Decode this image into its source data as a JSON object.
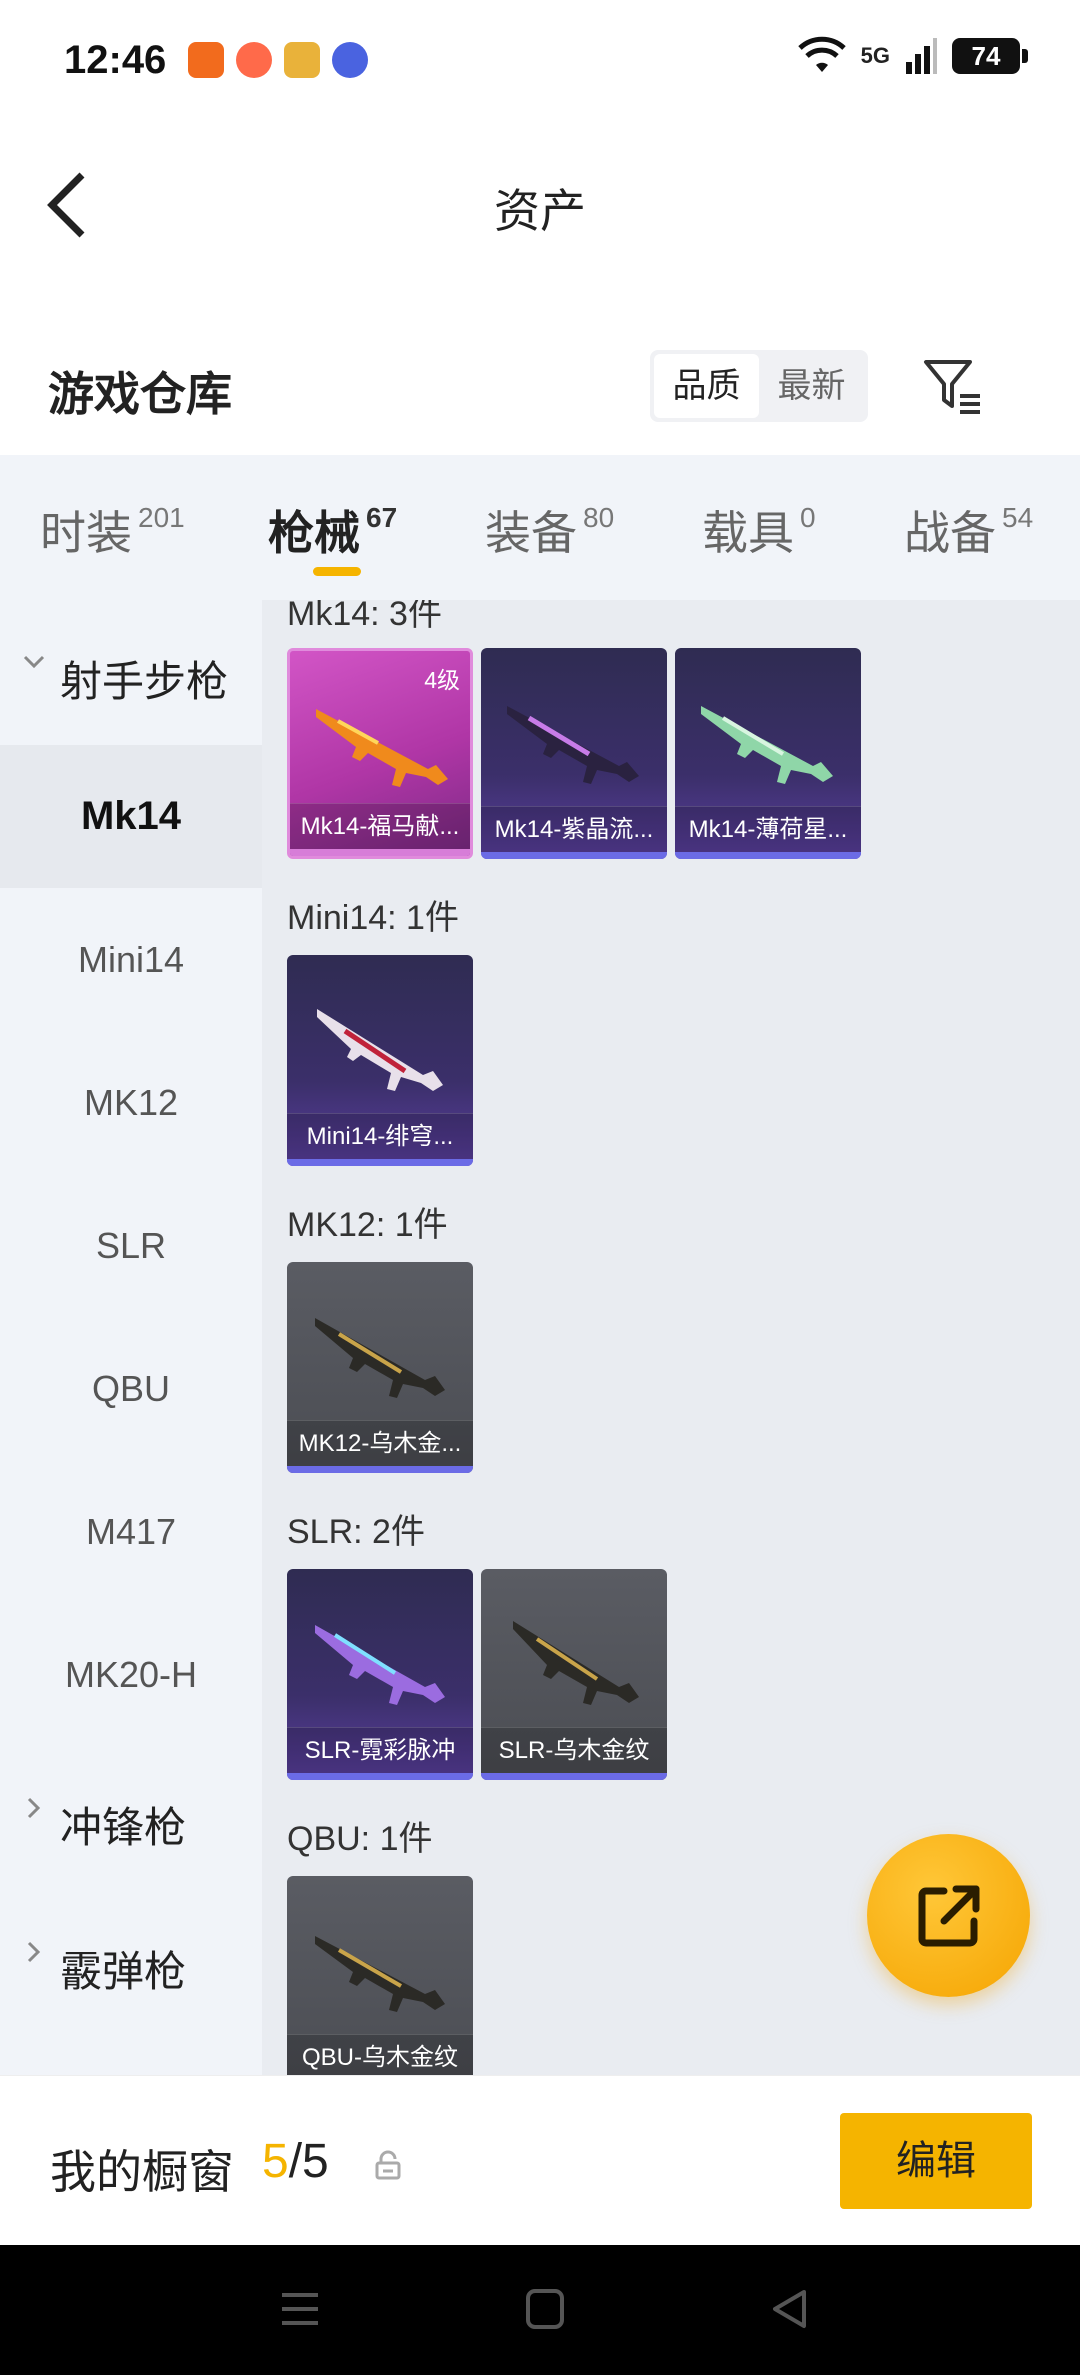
{
  "status_bar": {
    "time": "12:46",
    "network": "5G",
    "battery": "74",
    "colors": {
      "app1": "#f26b1d",
      "app2": "#ff5a3c",
      "app3": "#e9b23a",
      "app4": "#4a63e0"
    }
  },
  "header": {
    "title": "资产",
    "back_icon": "chevron-left-icon"
  },
  "warehouse": {
    "title": "游戏仓库",
    "sort_options": [
      "品质",
      "最新"
    ],
    "sort_selected": "品质",
    "filter_icon": "filter-icon"
  },
  "tabs": [
    {
      "label": "时装",
      "count": "201"
    },
    {
      "label": "枪械",
      "count": "67"
    },
    {
      "label": "装备",
      "count": "80"
    },
    {
      "label": "载具",
      "count": "0"
    },
    {
      "label": "战备",
      "count": "54"
    }
  ],
  "sidebar": {
    "group_marksman": "射手步枪",
    "items": [
      "Mk14",
      "Mini14",
      "MK12",
      "SLR",
      "QBU",
      "M417",
      "MK20-H"
    ],
    "group_smg": "冲锋枪",
    "group_shotgun": "霰弹枪"
  },
  "sections": {
    "mk14": {
      "title": "Mk14: 3件"
    },
    "mini14": {
      "title": "Mini14: 1件"
    },
    "mk12": {
      "title": "MK12: 1件"
    },
    "slr": {
      "title": "SLR: 2件"
    },
    "qbu": {
      "title": "QBU: 1件"
    }
  },
  "cards": {
    "mk14_1": {
      "name": "Mk14-福马献...",
      "level": "4级"
    },
    "mk14_2": {
      "name": "Mk14-紫晶流..."
    },
    "mk14_3": {
      "name": "Mk14-薄荷星..."
    },
    "mini14_1": {
      "name": "Mini14-绯穹..."
    },
    "mk12_1": {
      "name": "MK12-乌木金..."
    },
    "slr_1": {
      "name": "SLR-霓彩脉冲"
    },
    "slr_2": {
      "name": "SLR-乌木金纹"
    },
    "qbu_1": {
      "name": "QBU-乌木金纹"
    }
  },
  "fab": {
    "icon": "share-icon"
  },
  "showcase": {
    "label": "我的橱窗",
    "current": "5",
    "separator": "/",
    "total": "5",
    "edit_label": "编辑"
  },
  "accent_color": "#f5b400"
}
